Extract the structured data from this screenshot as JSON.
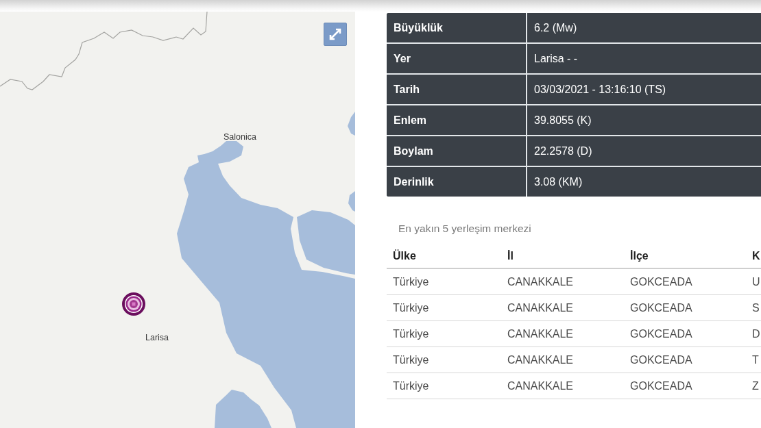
{
  "map": {
    "place_labels": [
      "Salonica",
      "Larisa"
    ]
  },
  "details": [
    {
      "label": "Büyüklük",
      "value": "6.2 (Mw)"
    },
    {
      "label": "Yer",
      "value": "Larisa - -"
    },
    {
      "label": "Tarih",
      "value": "03/03/2021 - 13:16:10 (TS)"
    },
    {
      "label": "Enlem",
      "value": "39.8055 (K)"
    },
    {
      "label": "Boylam",
      "value": "22.2578 (D)"
    },
    {
      "label": "Derinlik",
      "value": "3.08 (KM)"
    }
  ],
  "nearest": {
    "title": "En yakın 5 yerleşim merkezi",
    "columns": [
      "Ülke",
      "İl",
      "İlçe",
      "K"
    ],
    "rows": [
      [
        "Türkiye",
        "CANAKKALE",
        "GOKCEADA",
        "U"
      ],
      [
        "Türkiye",
        "CANAKKALE",
        "GOKCEADA",
        "S"
      ],
      [
        "Türkiye",
        "CANAKKALE",
        "GOKCEADA",
        "D"
      ],
      [
        "Türkiye",
        "CANAKKALE",
        "GOKCEADA",
        "T"
      ],
      [
        "Türkiye",
        "CANAKKALE",
        "GOKCEADA",
        "Z"
      ]
    ]
  }
}
